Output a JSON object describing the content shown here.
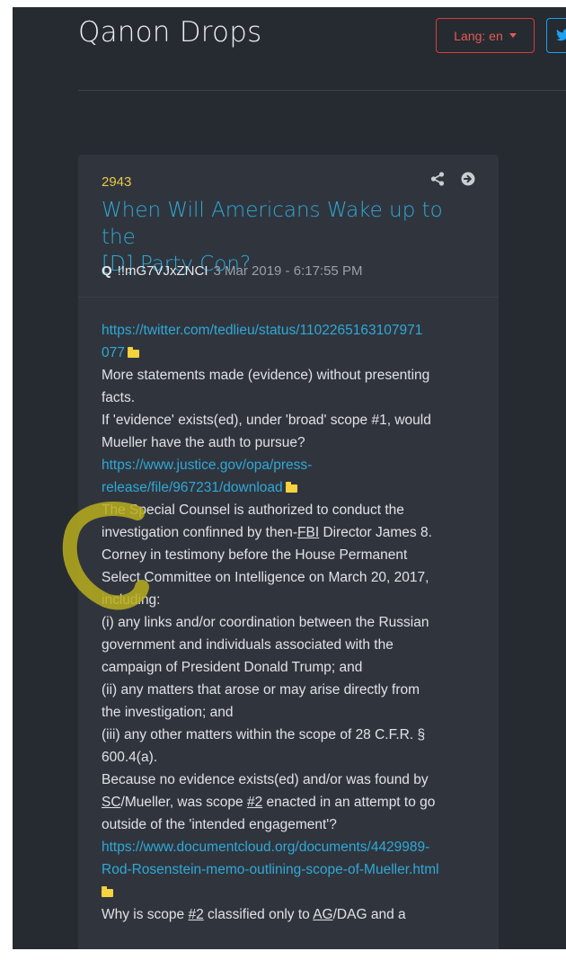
{
  "header": {
    "site_title": "Qanon Drops",
    "lang_label": "Lang: en",
    "twitter_icon": "twitter-icon"
  },
  "post": {
    "number": "2943",
    "title_line1": "When Will Americans Wake up to the",
    "title_line2": "[D] Party Con?",
    "author": "Q",
    "tripcode": "!!mG7VJxZNCI",
    "datetime": "3 Mar 2019 - 6:17:55 PM",
    "link1_line1": "https://twitter.com/tedlieu/status/1102265163107971",
    "link1_line2": "077",
    "p1_l1": "More statements made (evidence) without presenting",
    "p1_l2": "facts.",
    "p2_l1": "If 'evidence' exists(ed), under 'broad' scope #1, would",
    "p2_l2": "Mueller have the auth to pursue?",
    "link2_line1": "https://www.justice.gov/opa/press-",
    "link2_line2": "release/file/967231/download",
    "p3_l1": "The Special Counsel is authorized to conduct the",
    "p3_l2_a": "investigation confinned by then-",
    "p3_l2_fbi": "FBI",
    "p3_l2_b": " Director James 8.",
    "p3_l3": "Corney in testimony before the House Permanent",
    "p3_l4": "Select Committee on Intelligence on March 20, 2017,",
    "p3_l5": "including:",
    "p4_l1": "(i) any links and/or coordination between the Russian",
    "p4_l2": "government and individuals associated with the",
    "p4_l3": "campaign of President Donald Trump; and",
    "p5_l1": "(ii) any matters that arose or may arise directly from",
    "p5_l2": "the investigation; and",
    "p6_l1": "(iii) any other matters within the scope of 28 C.F.R. §",
    "p6_l2": "600.4(a).",
    "p7_l1": "Because no evidence exists(ed) and/or was found by",
    "p7_l2_sc": "SC",
    "p7_l2_a": "/Mueller, was scope ",
    "p7_l2_num": "#2",
    "p7_l2_b": " enacted in an attempt to go",
    "p7_l3": "outside of the 'intended engagement'?",
    "link3_line1": "https://www.documentcloud.org/documents/4429989-",
    "link3_line2": "Rod-Rosenstein-memo-outlining-scope-of-Mueller.html",
    "p8_a": "Why is scope ",
    "p8_num": "#2",
    "p8_b": " classified only to ",
    "p8_ag": "AG",
    "p8_c": "/DAG and a"
  },
  "colors": {
    "background": "#262a31",
    "card": "#30353d",
    "link": "#2fa8d8",
    "post_number": "#e9c84a",
    "lang_button": "#d43f3a",
    "folder": "#f5d23e",
    "annotation_marker": "#b8ad1e"
  },
  "icons": [
    "share-icon",
    "arrow-circle-right-icon",
    "folder-icon",
    "caret-down-icon",
    "twitter-icon"
  ]
}
